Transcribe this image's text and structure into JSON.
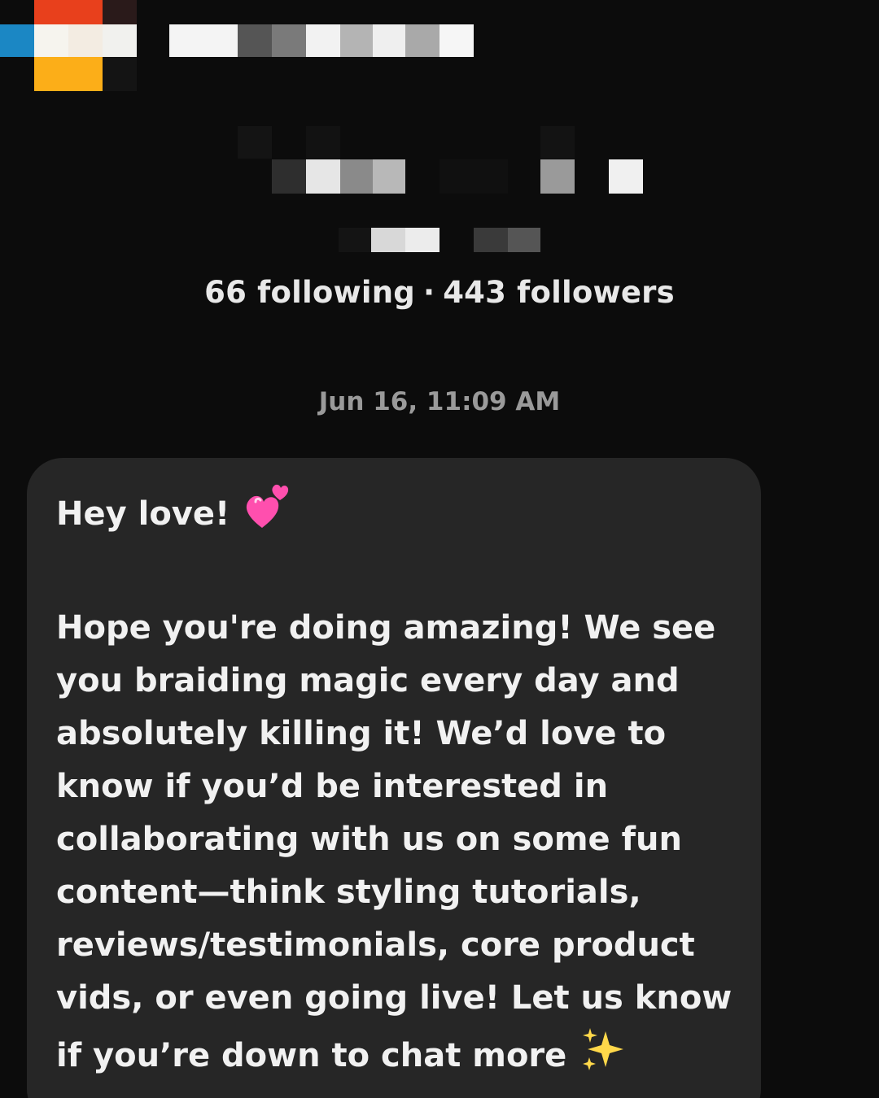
{
  "profile": {
    "following_count": "66",
    "following_label": "following",
    "separator": "·",
    "followers_count": "443",
    "followers_label": "followers"
  },
  "conversation": {
    "timestamp": "Jun 16, 11:09 AM",
    "message": {
      "greeting": "Hey love!",
      "greeting_emoji": "two-hearts-icon",
      "lines": [
        "Hope you're doing amazing! We see",
        "you braiding magic every day and",
        "absolutely killing it! We’d love to",
        "know if you’d be interested in",
        "collaborating with us on some fun",
        "content—think styling tutorials,",
        "reviews/testimonials, core product",
        "vids, or even going live! Let us know",
        "if you’re down to chat more"
      ],
      "closing_emoji": "sparkles-icon"
    }
  },
  "colors": {
    "background": "#0c0c0c",
    "bubble": "#262626",
    "text_primary": "#f1f1f1",
    "text_secondary": "#9a9a9a",
    "heart_pink": "#ff4fae",
    "sparkle_yellow": "#ffd84a"
  }
}
